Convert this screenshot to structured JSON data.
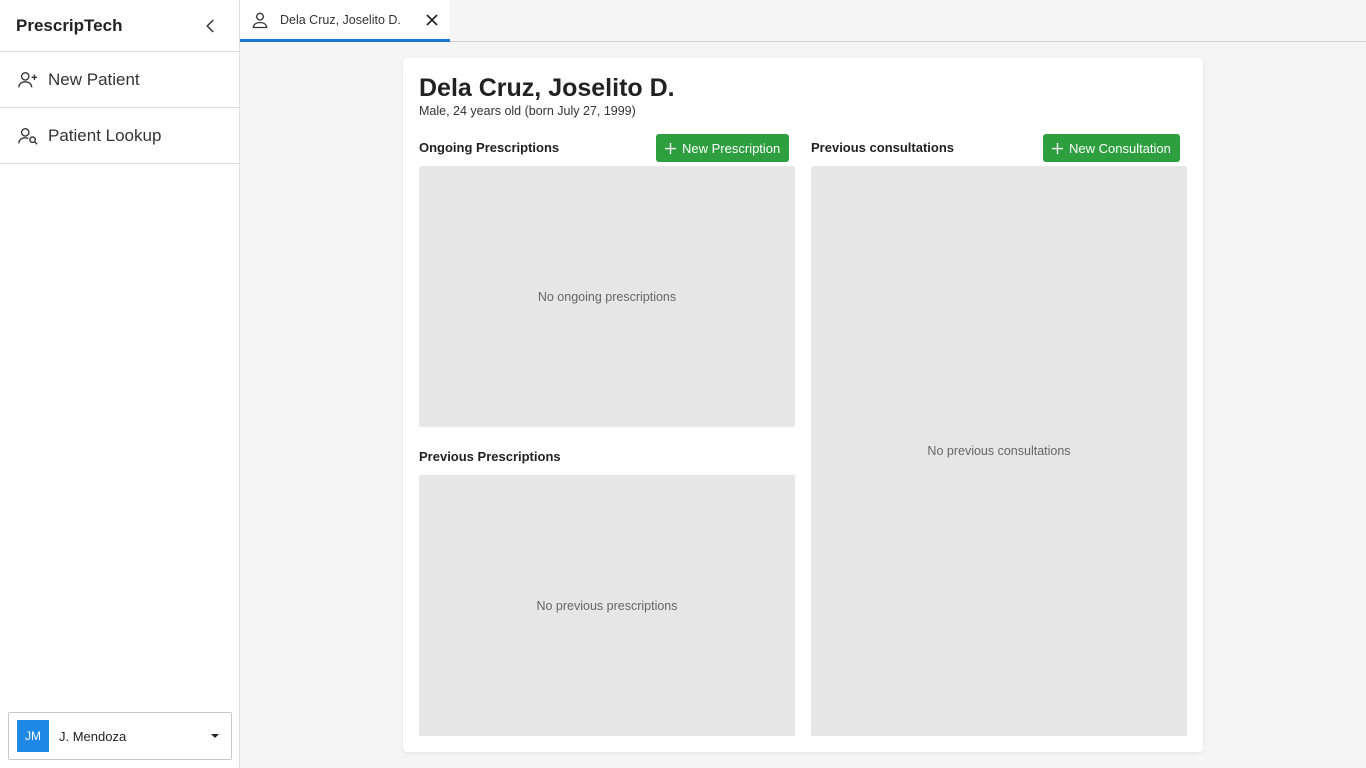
{
  "sidebar": {
    "brand": "PrescripTech",
    "items": [
      {
        "label": "New Patient",
        "icon": "person-add-icon"
      },
      {
        "label": "Patient Lookup",
        "icon": "person-search-icon"
      }
    ],
    "user": {
      "initials": "JM",
      "name": "J. Mendoza"
    }
  },
  "tabs": [
    {
      "label": "Dela Cruz, Joselito D.",
      "icon": "person-icon"
    }
  ],
  "patient": {
    "name": "Dela Cruz, Joselito D.",
    "details": "Male, 24 years old (born July 27, 1999)"
  },
  "sections": {
    "ongoing": {
      "title": "Ongoing Prescriptions",
      "button": "New Prescription",
      "empty": "No ongoing prescriptions"
    },
    "previous_prescriptions": {
      "title": "Previous Prescriptions",
      "empty": "No previous prescriptions"
    },
    "consultations": {
      "title": "Previous consultations",
      "button": "New Consultation",
      "empty": "No previous consultations"
    }
  },
  "colors": {
    "accent": "#1976d2",
    "button_green": "#2e9f3e",
    "avatar": "#1e88e5"
  }
}
